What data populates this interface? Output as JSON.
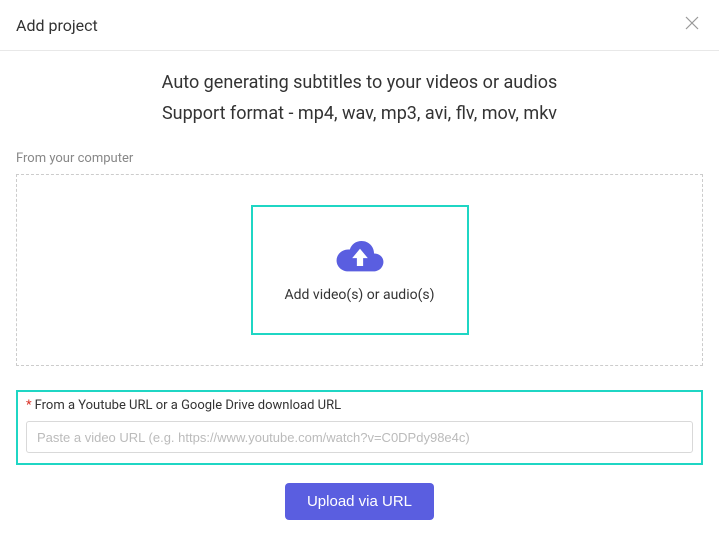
{
  "header": {
    "title": "Add project"
  },
  "intro": {
    "headline": "Auto generating subtitles to your videos or audios",
    "subheadline": "Support format - mp4, wav, mp3, avi, flv, mov, mkv"
  },
  "upload": {
    "section_label": "From your computer",
    "dropzone_text": "Add video(s) or audio(s)"
  },
  "url_section": {
    "label": "From a Youtube URL or a Google Drive download URL",
    "placeholder": "Paste a video URL (e.g. https://www.youtube.com/watch?v=C0DPdy98e4c)"
  },
  "actions": {
    "upload_button": "Upload via URL"
  }
}
